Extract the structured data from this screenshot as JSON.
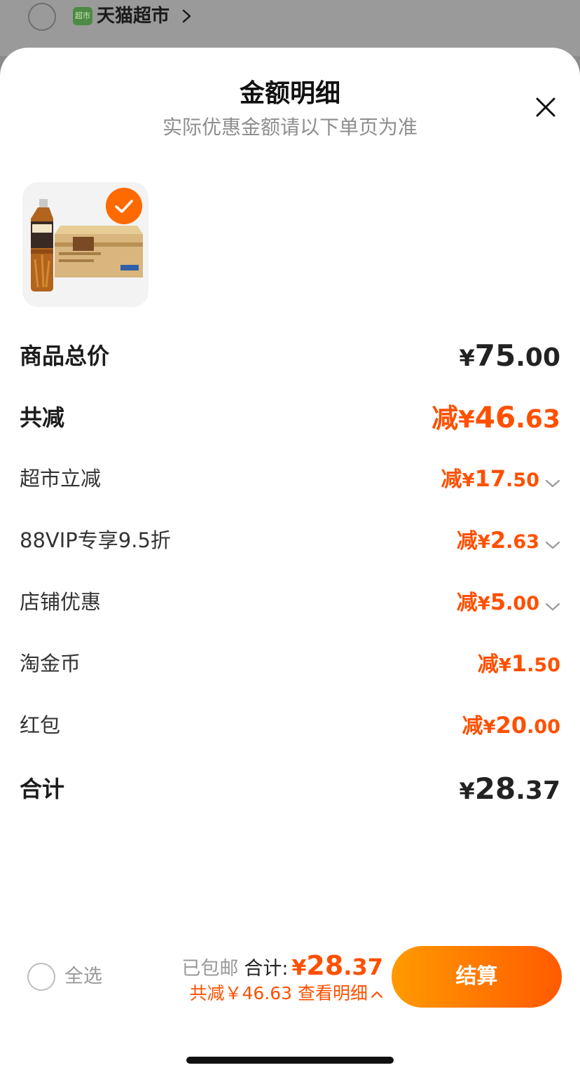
{
  "background": {
    "store_icon_text": "超市",
    "store_name": "天猫超市"
  },
  "sheet": {
    "title": "金额明细",
    "subtitle": "实际优惠金额请以下单页为准"
  },
  "product": {
    "selected": true
  },
  "rows": {
    "subtotal": {
      "label": "商品总价",
      "currency": "¥",
      "int": "75",
      "dec": ".00"
    },
    "total_discount": {
      "label": "共减",
      "prefix": "减",
      "currency": "¥",
      "int": "46",
      "dec": ".63"
    },
    "discounts": [
      {
        "label": "超市立减",
        "prefix": "减",
        "currency": "¥",
        "int": "17",
        "dec": ".50",
        "expandable": true
      },
      {
        "label": "88VIP专享9.5折",
        "prefix": "减",
        "currency": "¥",
        "int": "2",
        "dec": ".63",
        "expandable": true
      },
      {
        "label": "店铺优惠",
        "prefix": "减",
        "currency": "¥",
        "int": "5",
        "dec": ".00",
        "expandable": true
      },
      {
        "label": "淘金币",
        "prefix": "减",
        "currency": "¥",
        "int": "1",
        "dec": ".50",
        "expandable": false
      },
      {
        "label": "红包",
        "prefix": "减",
        "currency": "¥",
        "int": "20",
        "dec": ".00",
        "expandable": false
      }
    ],
    "grand_total": {
      "label": "合计",
      "currency": "¥",
      "int": "28",
      "dec": ".37"
    }
  },
  "bottom_bar": {
    "select_all_label": "全选",
    "free_shipping": "已包邮",
    "total_label": "合计:",
    "total_currency": "¥",
    "total_int": "28",
    "total_dec": ".37",
    "discount_summary": "共减￥46.63",
    "view_details": "查看明细",
    "checkout_label": "结算"
  },
  "colors": {
    "accent": "#ff5000",
    "button_gradient_start": "#ff9a00",
    "button_gradient_end": "#ff5a00"
  }
}
